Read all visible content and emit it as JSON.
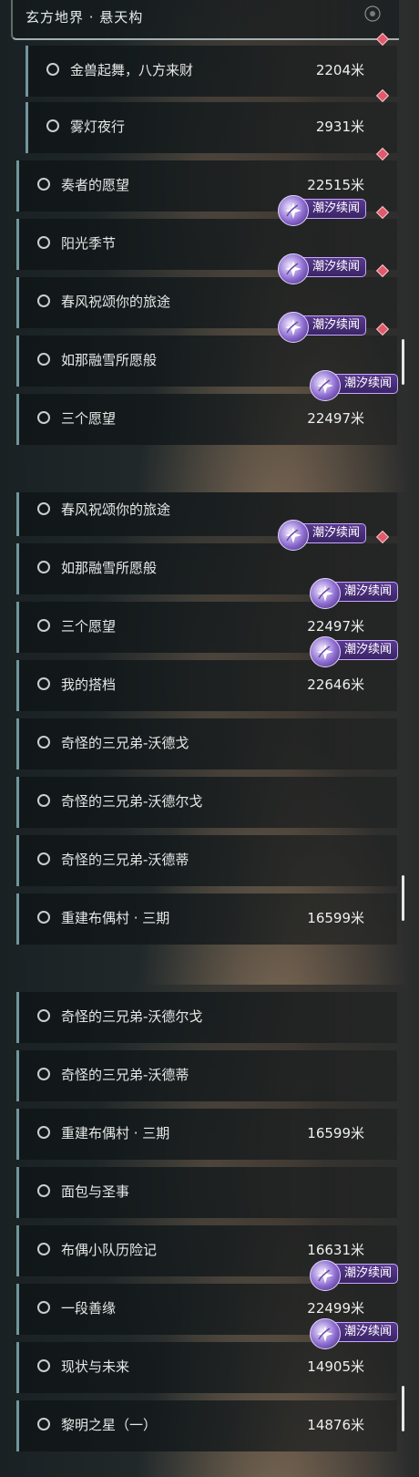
{
  "header": {
    "title": "玄方地界 · 悬天构"
  },
  "distance_unit": "米",
  "badge_label": "潮汐续闻",
  "colors": {
    "accent_badge": "#5a3a8e",
    "marker": "#e05a6c",
    "row_edge": "#96c8d2"
  },
  "panels": [
    {
      "rows": [
        {
          "label": "金兽起舞，八方来财",
          "distance": "2204米",
          "sub": true,
          "marker": true,
          "badge": false
        },
        {
          "label": "雾灯夜行",
          "distance": "2931米",
          "sub": true,
          "marker": true,
          "badge": false
        },
        {
          "label": "奏者的愿望",
          "distance": "22515米",
          "sub": false,
          "marker": true,
          "badge": false
        },
        {
          "label": "阳光季节",
          "distance": "",
          "sub": false,
          "marker": true,
          "badge": true
        },
        {
          "label": "春风祝颂你的旅途",
          "distance": "",
          "sub": false,
          "marker": true,
          "badge": true
        },
        {
          "label": "如那融雪所愿般",
          "distance": "",
          "sub": false,
          "marker": true,
          "badge": true
        },
        {
          "label": "三个愿望",
          "distance": "22497米",
          "sub": false,
          "marker": false,
          "badge": true
        }
      ]
    },
    {
      "rows": [
        {
          "label": "春风祝颂你的旅途",
          "distance": "",
          "sub": false,
          "marker": true,
          "badge": true
        },
        {
          "label": "如那融雪所愿般",
          "distance": "",
          "sub": false,
          "marker": true,
          "badge": true
        },
        {
          "label": "三个愿望",
          "distance": "22497米",
          "sub": false,
          "marker": false,
          "badge": true
        },
        {
          "label": "我的搭档",
          "distance": "22646米",
          "sub": false,
          "marker": false,
          "badge": true
        },
        {
          "label": "奇怪的三兄弟-沃德戈",
          "distance": "",
          "sub": false,
          "marker": false,
          "badge": false
        },
        {
          "label": "奇怪的三兄弟-沃德尔戈",
          "distance": "",
          "sub": false,
          "marker": false,
          "badge": false
        },
        {
          "label": "奇怪的三兄弟-沃德蒂",
          "distance": "",
          "sub": false,
          "marker": false,
          "badge": false
        },
        {
          "label": "重建布偶村 · 三期",
          "distance": "16599米",
          "sub": false,
          "marker": false,
          "badge": false
        }
      ]
    },
    {
      "rows": [
        {
          "label": "奇怪的三兄弟-沃德尔戈",
          "distance": "",
          "sub": false,
          "marker": false,
          "badge": false
        },
        {
          "label": "奇怪的三兄弟-沃德蒂",
          "distance": "",
          "sub": false,
          "marker": false,
          "badge": false
        },
        {
          "label": "重建布偶村 · 三期",
          "distance": "16599米",
          "sub": false,
          "marker": false,
          "badge": false
        },
        {
          "label": "面包与圣事",
          "distance": "",
          "sub": false,
          "marker": false,
          "badge": false
        },
        {
          "label": "布偶小队历险记",
          "distance": "16631米",
          "sub": false,
          "marker": false,
          "badge": false
        },
        {
          "label": "一段善缘",
          "distance": "22499米",
          "sub": false,
          "marker": false,
          "badge": true
        },
        {
          "label": "现状与未来",
          "distance": "14905米",
          "sub": false,
          "marker": false,
          "badge": true
        },
        {
          "label": "黎明之星（一）",
          "distance": "14876米",
          "sub": false,
          "marker": false,
          "badge": false
        }
      ]
    }
  ]
}
